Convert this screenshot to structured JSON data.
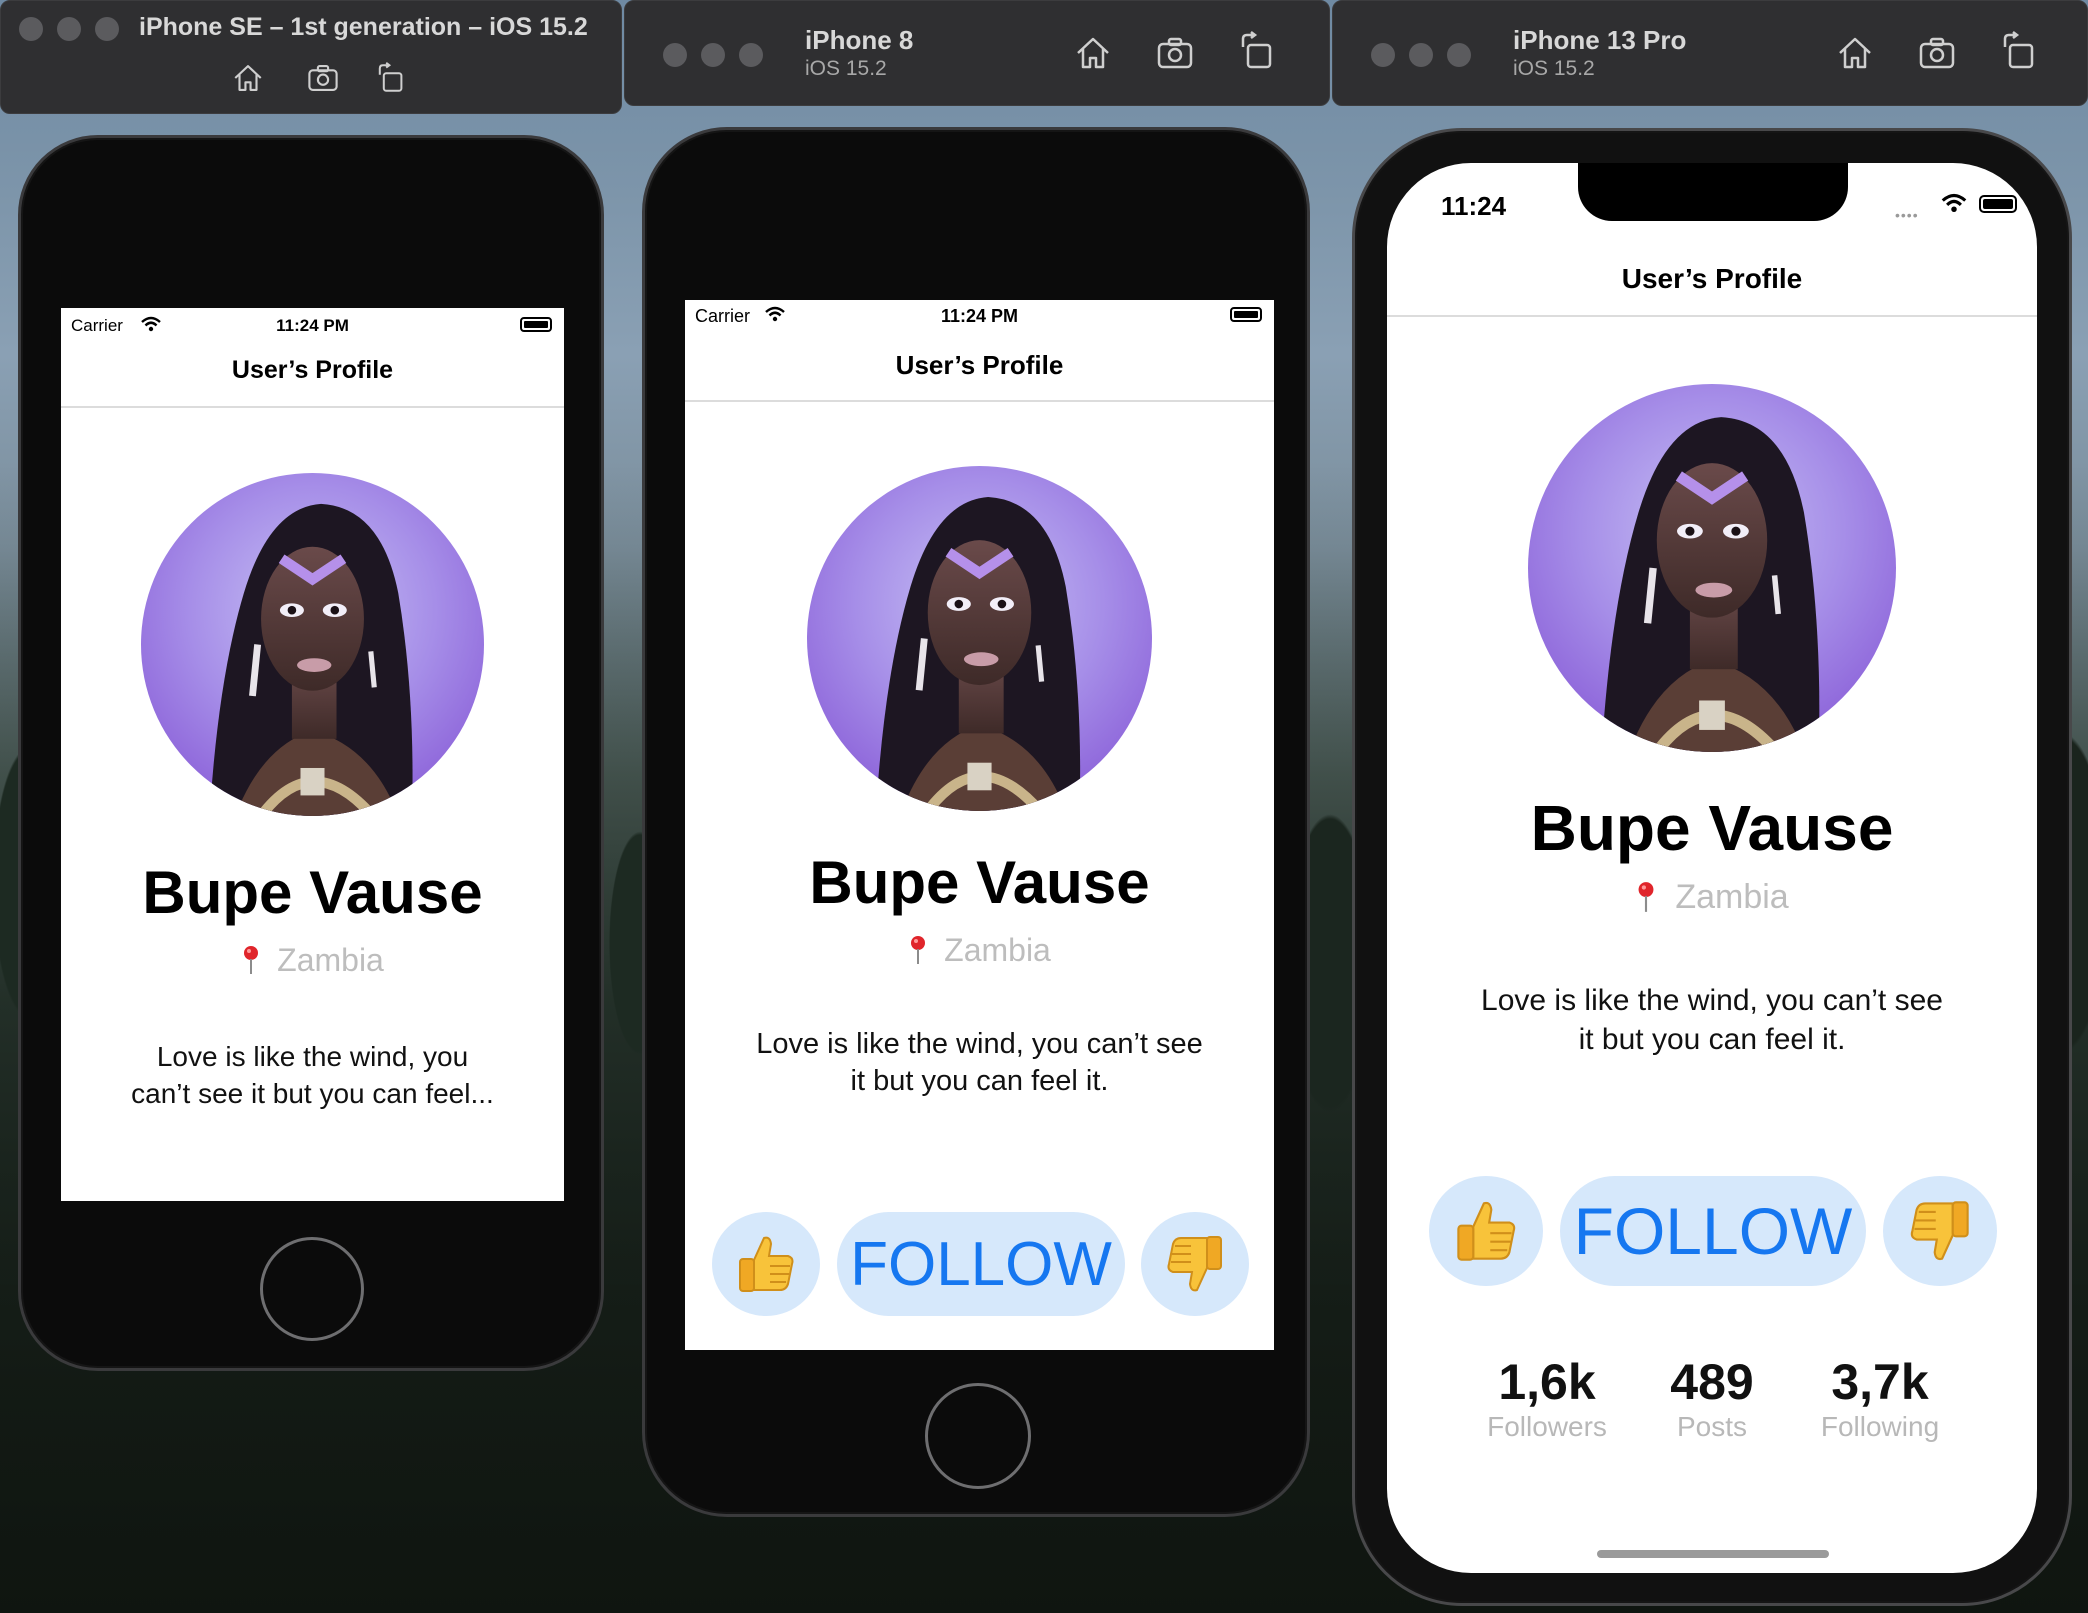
{
  "windows": [
    {
      "title": "iPhone SE – 1st generation – iOS 15.2"
    },
    {
      "title": "iPhone 8",
      "subtitle": "iOS 15.2"
    },
    {
      "title": "iPhone 13 Pro",
      "subtitle": "iOS 15.2"
    }
  ],
  "status": {
    "carrier": "Carrier",
    "time_legacy": "11:24 PM",
    "time_notch": "11:24"
  },
  "nav": {
    "title": "User’s Profile"
  },
  "profile": {
    "name": "Bupe Vause",
    "location": "Zambia",
    "bio": "Love is like the wind, you can’t see it but you can feel it.",
    "bio_truncated": "Love is like the wind, you can’t see it but you can feel...",
    "bio_line1_se": "Love is like the wind, you",
    "bio_line2_se": "can’t see it but you can feel...",
    "bio_line1": "Love is like the wind, you can’t see",
    "bio_line2": "it but you can feel it."
  },
  "actions": {
    "follow_label": "FOLLOW",
    "like_icon": "thumbs-up-icon",
    "dislike_icon": "thumbs-down-icon"
  },
  "stats": [
    {
      "value": "1,6k",
      "label": "Followers"
    },
    {
      "value": "489",
      "label": "Posts"
    },
    {
      "value": "3,7k",
      "label": "Following"
    }
  ],
  "colors": {
    "accent": "#1677f0",
    "button_bg": "#d6e8fb",
    "secondary_text": "#bdbdbd"
  }
}
